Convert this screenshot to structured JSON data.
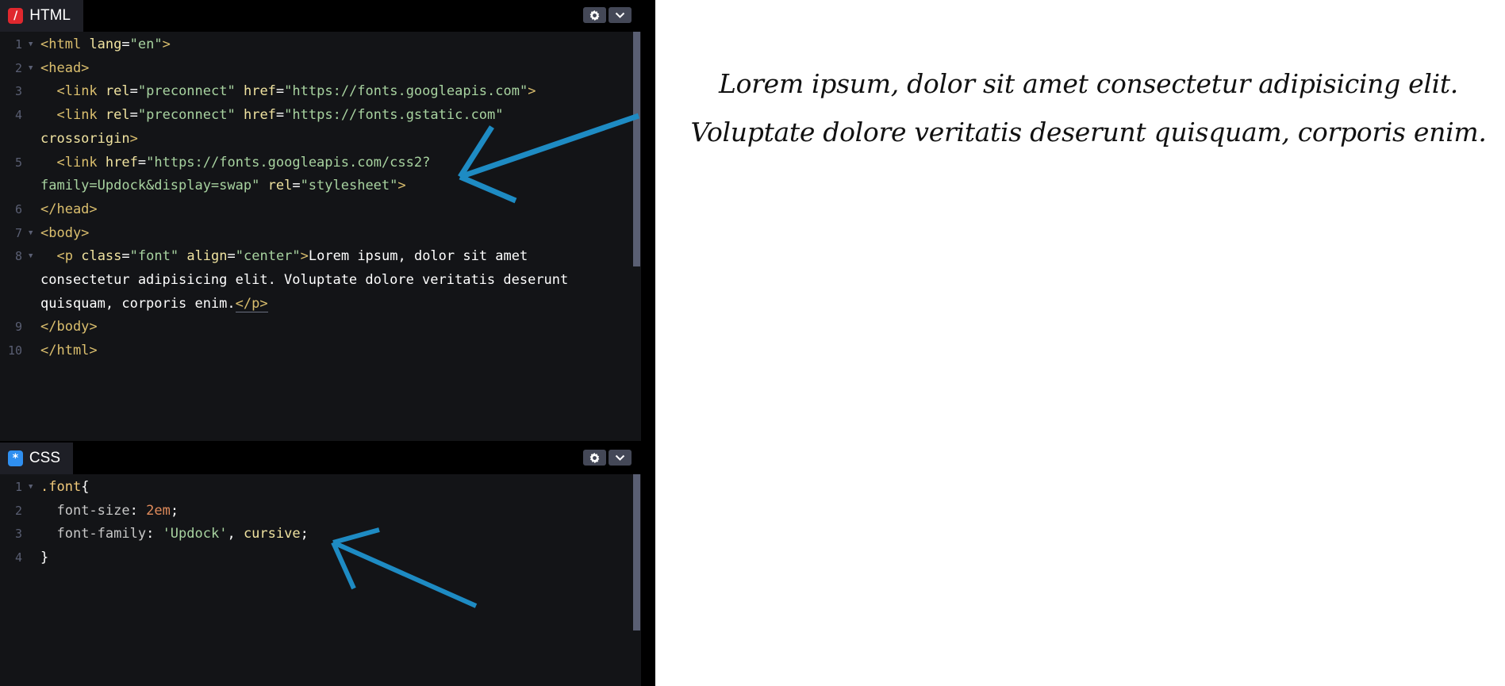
{
  "html_pane": {
    "title": "HTML",
    "icon": "html-logo-icon",
    "lines": [
      {
        "n": "1",
        "html": "<span class='t'>&lt;html</span> <span class='a'>lang</span><span class='p'>=</span><span class='s'>\"en\"</span><span class='t'>&gt;</span>"
      },
      {
        "n": "2",
        "html": "<span class='t'>&lt;head&gt;</span>"
      },
      {
        "n": "3",
        "html": "  <span class='t'>&lt;link</span> <span class='a'>rel</span><span class='p'>=</span><span class='s'>\"preconnect\"</span> <span class='a'>href</span><span class='p'>=</span><span class='s'>\"https://fonts.googleapis.com\"</span><span class='t'>&gt;</span>"
      },
      {
        "n": "4",
        "html": "  <span class='t'>&lt;link</span> <span class='a'>rel</span><span class='p'>=</span><span class='s'>\"preconnect\"</span> <span class='a'>href</span><span class='p'>=</span><span class='s'>\"https://fonts.gstatic.com\"</span>"
      },
      {
        "n": "",
        "html": "<span class='a'>crossorigin</span><span class='t'>&gt;</span>"
      },
      {
        "n": "5",
        "html": "  <span class='t'>&lt;link</span> <span class='a'>href</span><span class='p'>=</span><span class='s'>\"https://fonts.googleapis.com/css2?</span>"
      },
      {
        "n": "",
        "html": "<span class='s'>family=Updock&amp;display=swap\"</span> <span class='a'>rel</span><span class='p'>=</span><span class='s'>\"stylesheet\"</span><span class='t'>&gt;</span>"
      },
      {
        "n": "6",
        "html": "<span class='t'>&lt;/head&gt;</span>"
      },
      {
        "n": "7",
        "html": "<span class='t'>&lt;body&gt;</span>"
      },
      {
        "n": "8",
        "html": "  <span class='t'>&lt;p</span> <span class='a'>class</span><span class='p'>=</span><span class='s'>\"font\"</span> <span class='a'>align</span><span class='p'>=</span><span class='s'>\"center\"</span><span class='t'>&gt;</span><span class='txt'>Lorem ipsum, dolor sit amet</span>"
      },
      {
        "n": "",
        "html": "<span class='txt'>consectetur adipisicing elit. Voluptate dolore veritatis deserunt</span>"
      },
      {
        "n": "",
        "html": "<span class='txt'>quisquam, corporis enim.</span><span class='t underline'>&lt;/p&gt;</span>"
      },
      {
        "n": "9",
        "html": "<span class='t'>&lt;/body&gt;</span>"
      },
      {
        "n": "10",
        "html": "<span class='t'>&lt;/html&gt;</span>"
      }
    ]
  },
  "css_pane": {
    "title": "CSS",
    "icon": "css-logo-icon",
    "lines": [
      {
        "n": "1",
        "html": "<span class='sel'>.font</span><span class='brace'>{</span>"
      },
      {
        "n": "2",
        "html": "  <span class='prop'>font-size</span><span class='p'>: </span><span class='num'>2em</span><span class='p'>;</span>"
      },
      {
        "n": "3",
        "html": "  <span class='prop'>font-family</span><span class='p'>: </span><span class='s'>'Updock'</span><span class='p'>, </span><span class='kw'>cursive</span><span class='p'>;</span>"
      },
      {
        "n": "4",
        "html": "<span class='brace'>}</span>"
      }
    ]
  },
  "preview": {
    "text": "Lorem ipsum, dolor sit amet consectetur adipisicing elit. Voluptate dolore veritatis deserunt quisquam, corporis enim."
  },
  "colors": {
    "arrow": "#1e8bc3",
    "editor_bg": "#131417",
    "header_bg": "#000000",
    "tab_bg": "#1e1f26",
    "html_icon": "#e0282e",
    "css_icon": "#2f8ff0"
  }
}
